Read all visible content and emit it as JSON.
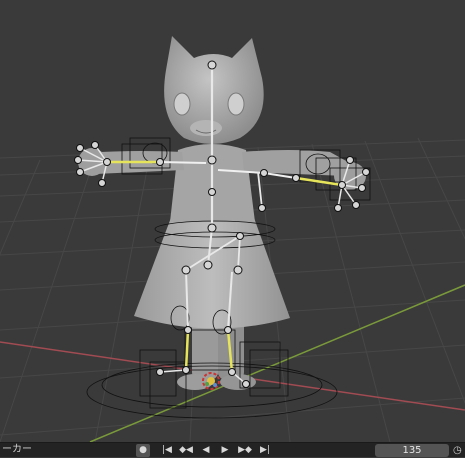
{
  "timeline": {
    "left_label": "ーカー",
    "current_frame": "135",
    "buttons": [
      {
        "name": "keyframe-dot-button",
        "glyph": "●",
        "icon": "keyframe-icon"
      },
      {
        "name": "jump-to-start-button",
        "glyph": "|◀",
        "icon": "jump-start-icon"
      },
      {
        "name": "prev-keyframe-button",
        "glyph": "◆◀",
        "icon": "prev-keyframe-icon"
      },
      {
        "name": "play-reverse-button",
        "glyph": "◀",
        "icon": "play-reverse-icon"
      },
      {
        "name": "play-button",
        "glyph": "▶",
        "icon": "play-icon"
      },
      {
        "name": "next-keyframe-button",
        "glyph": "▶◆",
        "icon": "next-keyframe-icon"
      },
      {
        "name": "jump-to-end-button",
        "glyph": "▶|",
        "icon": "jump-end-icon"
      }
    ],
    "clock_glyph": "◷"
  },
  "colors": {
    "background": "#3a3a3a",
    "grid": "#4a4a4a",
    "x_axis": "#a14b52",
    "y_axis": "#7a9a3a",
    "model": "#a8a8a8",
    "bone_outline": "#101010",
    "bone_selected": "#e6e45a",
    "timeline_bg": "#232323"
  }
}
